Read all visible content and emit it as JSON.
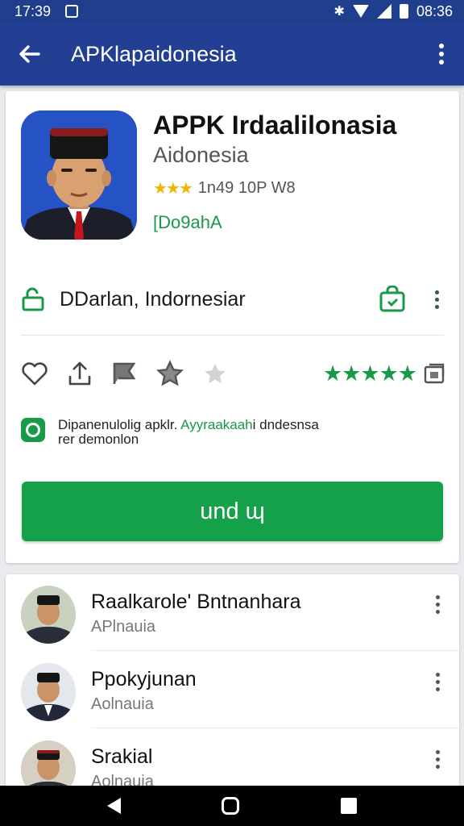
{
  "status_bar": {
    "time_left": "17:39",
    "time_right": "08:36"
  },
  "app_bar": {
    "title": "APKlapaidonesia",
    "back_icon": "arrow-left-icon",
    "more_icon": "more-vert-icon"
  },
  "app": {
    "name": "APPK Irdaalilonasia",
    "developer": "Aidonesia",
    "rating_stars": 3,
    "rating_text": "1n49 10P  W8",
    "tag": "[Do9ahA"
  },
  "app_row": {
    "label": "DDarlan, Indornesiar"
  },
  "actions": {
    "icons": [
      "heart-icon",
      "share-icon",
      "flag-icon",
      "star-outline-icon",
      "star-faded-icon"
    ],
    "stars": "★★★★★"
  },
  "info": {
    "text_plain": "Dipanenulolig apklr. ",
    "text_green": "Ayyraakaah",
    "text_end": "i dndesnsa",
    "line2": "rer demonlon"
  },
  "install_button": {
    "label": "und ɰ"
  },
  "list": [
    {
      "name": "Raalkarole' Bntnanhara",
      "sub": "APlnauia"
    },
    {
      "name": "Ppokyjunan",
      "sub": "Aolnauia"
    },
    {
      "name": "Srakial",
      "sub": "Aolnauia"
    }
  ],
  "colors": {
    "primary": "#223f93",
    "accent_green": "#15a04a",
    "star_gold": "#f0b400"
  }
}
